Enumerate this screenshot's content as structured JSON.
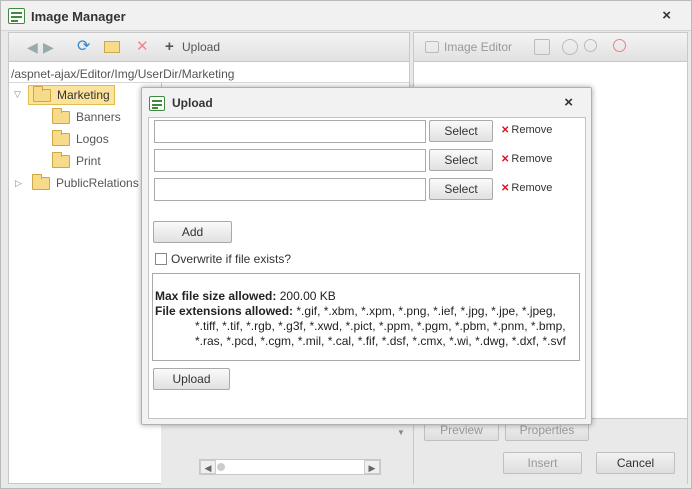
{
  "window": {
    "title": "Image Manager",
    "close": "×"
  },
  "toolbar": {
    "back_icon": "arrow-left-icon",
    "forward_icon": "arrow-right-icon",
    "upload_label": "Upload"
  },
  "path": "/aspnet-ajax/Editor/Img/UserDir/Marketing",
  "tree": {
    "marketing": "Marketing",
    "banners": "Banners",
    "logos": "Logos",
    "print": "Print",
    "public_relations": "PublicRelations"
  },
  "right_toolbar": {
    "image_editor_label": "Image Editor"
  },
  "right_buttons": {
    "preview": "Preview",
    "properties": "Properties",
    "insert": "Insert",
    "cancel": "Cancel"
  },
  "modal": {
    "title": "Upload",
    "close": "×",
    "file_rows": [
      {
        "value": "",
        "select_label": "Select",
        "remove_label": "Remove"
      },
      {
        "value": "",
        "select_label": "Select",
        "remove_label": "Remove"
      },
      {
        "value": "",
        "select_label": "Select",
        "remove_label": "Remove"
      }
    ],
    "add_label": "Add",
    "overwrite_label": "Overwrite if file exists?",
    "overwrite_checked": false,
    "max_size_label": "Max file size allowed:",
    "max_size_value": "200.00 KB",
    "ext_label": "File extensions allowed:",
    "ext_line1": "*.gif, *.xbm, *.xpm, *.png, *.ief, *.jpg, *.jpe, *.jpeg,",
    "ext_line2": "*.tiff, *.tif, *.rgb, *.g3f, *.xwd, *.pict, *.ppm, *.pgm, *.pbm, *.pnm, *.bmp,",
    "ext_line3": "*.ras, *.pcd, *.cgm, *.mil, *.cal, *.fif, *.dsf, *.cmx, *.wi, *.dwg, *.dxf, *.svf",
    "upload_label": "Upload"
  },
  "colors": {
    "accent": "#3f8a3f",
    "remove_x": "#dd1122",
    "selected_folder": "#fbe39b"
  }
}
